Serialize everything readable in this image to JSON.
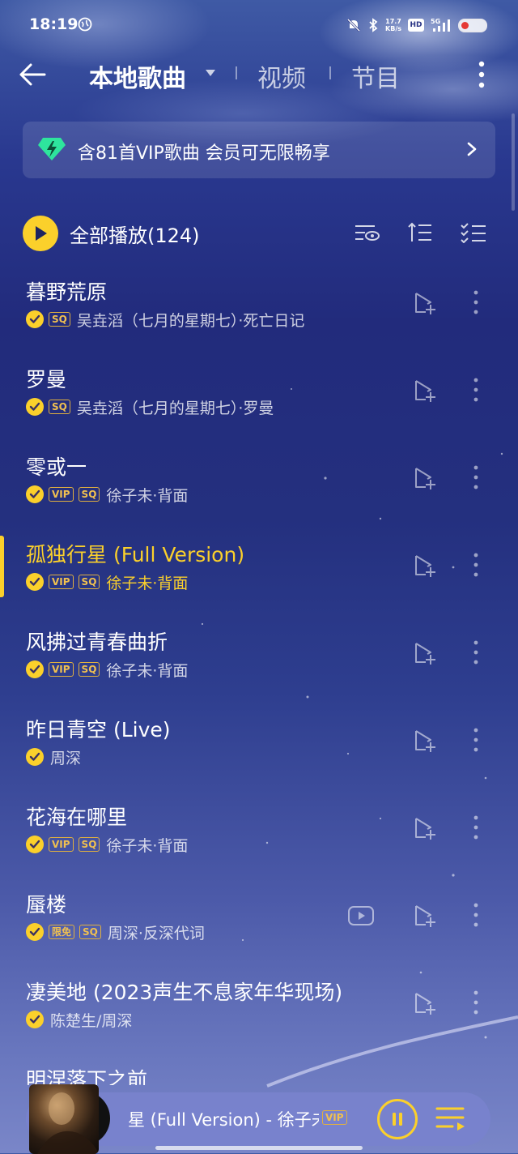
{
  "status_bar": {
    "time": "18:19",
    "net_speed_value": "17.7",
    "net_speed_unit": "KB/s",
    "hd_label": "HD",
    "signal_label": "5G",
    "icons": [
      "globe-icon",
      "mute-bell-icon",
      "bluetooth-icon",
      "signal-icon",
      "battery-icon"
    ]
  },
  "header": {
    "tabs": [
      {
        "label": "本地歌曲",
        "active": true
      },
      {
        "label": "视频",
        "active": false
      },
      {
        "label": "节目",
        "active": false
      }
    ]
  },
  "vip_banner": {
    "text": "含81首VIP歌曲 会员可无限畅享"
  },
  "play_all": {
    "label": "全部播放(124)"
  },
  "songs": [
    {
      "title": "暮野荒原",
      "tags": [
        "SQ"
      ],
      "artist": "吴垚滔（七月的星期七）·死亡日记",
      "active": false,
      "video": false
    },
    {
      "title": "罗曼",
      "tags": [
        "SQ"
      ],
      "artist": "吴垚滔（七月的星期七）·罗曼",
      "active": false,
      "video": false
    },
    {
      "title": "零或一",
      "tags": [
        "VIP",
        "SQ"
      ],
      "artist": "徐子未·背面",
      "active": false,
      "video": false
    },
    {
      "title": "孤独行星 (Full Version)",
      "tags": [
        "VIP",
        "SQ"
      ],
      "artist": "徐子未·背面",
      "active": true,
      "video": false
    },
    {
      "title": "风拂过青春曲折",
      "tags": [
        "VIP",
        "SQ"
      ],
      "artist": "徐子未·背面",
      "active": false,
      "video": false
    },
    {
      "title": "昨日青空 (Live)",
      "tags": [],
      "artist": "周深",
      "active": false,
      "video": false
    },
    {
      "title": "花海在哪里",
      "tags": [
        "VIP",
        "SQ"
      ],
      "artist": "徐子未·背面",
      "active": false,
      "video": false
    },
    {
      "title": "蜃楼",
      "tags": [
        "限免",
        "SQ"
      ],
      "artist": "周深·反深代词",
      "active": false,
      "video": true
    },
    {
      "title": "凄美地 (2023声生不息家年华现场)",
      "tags": [],
      "artist": "陈楚生/周深",
      "active": false,
      "video": false
    },
    {
      "title": "明涅落下之前",
      "tags": [],
      "artist": "",
      "active": false,
      "video": false
    }
  ],
  "player": {
    "now_playing": "星 (Full Version) - 徐子未",
    "vip_tag": "VIP"
  },
  "colors": {
    "accent": "#fbd02b",
    "tag": "#f0c050",
    "banner_icon": "#2ee59d"
  }
}
